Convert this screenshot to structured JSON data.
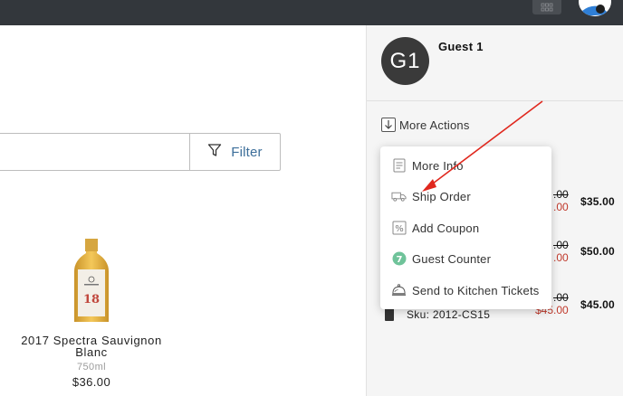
{
  "app": {
    "grid_icon": "grid-icon",
    "user_icon": "user-avatar-icon"
  },
  "search": {
    "value": "",
    "filter_label": "Filter",
    "filter_icon": "funnel-icon"
  },
  "product": {
    "name": "2017 Spectra Sauvignon Blanc",
    "size": "750ml",
    "price": "$36.00",
    "label_number": "18"
  },
  "guest": {
    "initials": "G1",
    "name": "Guest 1"
  },
  "more_actions": {
    "label": "More Actions",
    "icon": "arrow-down-box-icon"
  },
  "menu": {
    "items": [
      {
        "label": "More Info",
        "icon": "document-icon"
      },
      {
        "label": "Ship Order",
        "icon": "truck-icon"
      },
      {
        "label": "Add Coupon",
        "icon": "percent-icon"
      },
      {
        "label": "Guest Counter",
        "icon": "counter-badge-icon",
        "badge": "7"
      },
      {
        "label": "Send to Kitchen Tickets",
        "icon": "cloche-icon"
      }
    ]
  },
  "order_lines": [
    {
      "orig": ".00",
      "disc": ".00",
      "price": "$35.00"
    },
    {
      "orig": ".00",
      "disc": ".00",
      "price": "$50.00"
    },
    {
      "orig": ".00",
      "disc": "$45.00",
      "price": "$45.00",
      "sku": "Sku: 2012-CS15"
    }
  ],
  "colors": {
    "topbar": "#33373c",
    "filter_text": "#3c6e9a",
    "discount_red": "#c0392b",
    "annotation_arrow": "#e0281e",
    "guest_counter_badge": "#6fc39a"
  }
}
